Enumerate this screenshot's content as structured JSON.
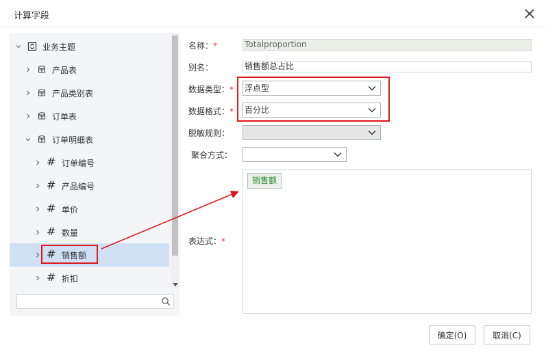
{
  "dialog": {
    "title": "计算字段",
    "close_icon": "close-icon"
  },
  "tree": {
    "root": {
      "label": "业务主题",
      "icon": "subject-icon"
    },
    "tables": [
      {
        "label": "产品表"
      },
      {
        "label": "产品类别表"
      },
      {
        "label": "订单表"
      },
      {
        "label": "订单明细表"
      }
    ],
    "fields": [
      {
        "label": "订单编号"
      },
      {
        "label": "产品编号"
      },
      {
        "label": "单价"
      },
      {
        "label": "数量"
      },
      {
        "label": "销售额"
      },
      {
        "label": "折扣"
      }
    ],
    "field_icon_glyph": "#",
    "search_placeholder": ""
  },
  "form": {
    "name_label": "名称：",
    "name_value": "Totalproportion",
    "alias_label": "别名：",
    "alias_value": "销售额总占比",
    "data_type_label": "数据类型：",
    "data_type_value": "浮点型",
    "data_format_label": "数据格式：",
    "data_format_value": "百分比",
    "masking_label": "脱敏规则：",
    "masking_value": "",
    "aggregation_label": "聚合方式：",
    "aggregation_value": "",
    "expression_label": "表达式：",
    "expression_token": "销售额",
    "required_mark": "*"
  },
  "buttons": {
    "ok": "确定(O)",
    "cancel": "取消(C)"
  },
  "colors": {
    "highlight": "#e0161b",
    "selected_row": "#cfe0f5",
    "token_text": "#2a8a2a"
  }
}
